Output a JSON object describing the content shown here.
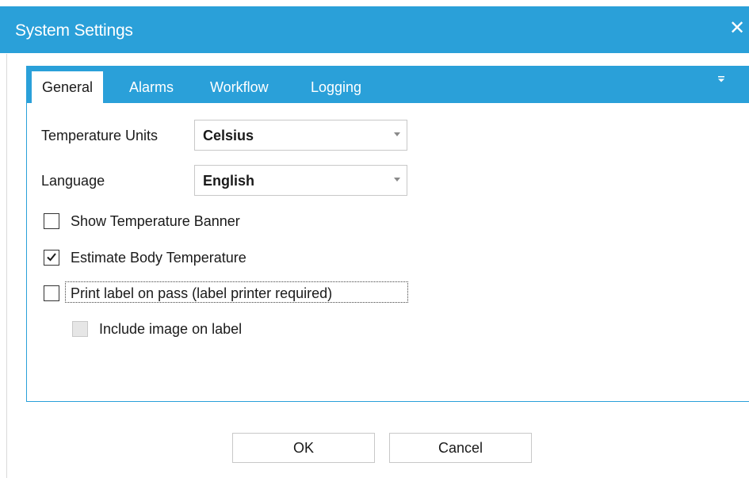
{
  "window": {
    "title": "System Settings",
    "close_glyph": "✕"
  },
  "tabs": [
    {
      "label": "General",
      "active": true
    },
    {
      "label": "Alarms",
      "active": false
    },
    {
      "label": "Workflow",
      "active": false
    },
    {
      "label": "Logging",
      "active": false
    }
  ],
  "tab_overflow_icon": "tab-dropdown-icon",
  "general": {
    "temperature_units": {
      "label": "Temperature Units",
      "value": "Celsius"
    },
    "language": {
      "label": "Language",
      "value": "English"
    },
    "show_banner": {
      "label": "Show Temperature Banner",
      "checked": false
    },
    "estimate_body": {
      "label": "Estimate Body Temperature",
      "checked": true
    },
    "print_label": {
      "label": "Print label on pass (label printer required)",
      "checked": false
    },
    "include_image": {
      "label": "Include image on label",
      "checked": false,
      "enabled": false
    }
  },
  "buttons": {
    "ok": "OK",
    "cancel": "Cancel"
  },
  "colors": {
    "accent": "#2aa0d9",
    "border": "#c8c8c8"
  }
}
